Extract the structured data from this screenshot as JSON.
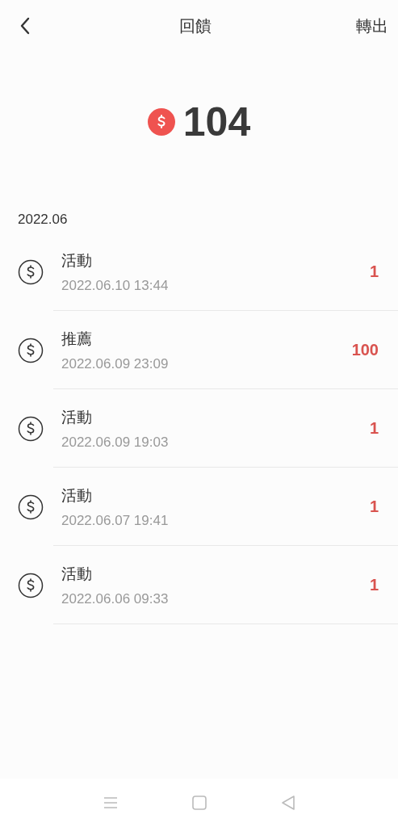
{
  "header": {
    "title": "回饋",
    "action": "轉出"
  },
  "balance": {
    "amount": "104"
  },
  "section": {
    "label": "2022.06"
  },
  "records": [
    {
      "title": "活動",
      "time": "2022.06.10 13:44",
      "amount": "1"
    },
    {
      "title": "推薦",
      "time": "2022.06.09 23:09",
      "amount": "100"
    },
    {
      "title": "活動",
      "time": "2022.06.09 19:03",
      "amount": "1"
    },
    {
      "title": "活動",
      "time": "2022.06.07 19:41",
      "amount": "1"
    },
    {
      "title": "活動",
      "time": "2022.06.06 09:33",
      "amount": "1"
    }
  ]
}
